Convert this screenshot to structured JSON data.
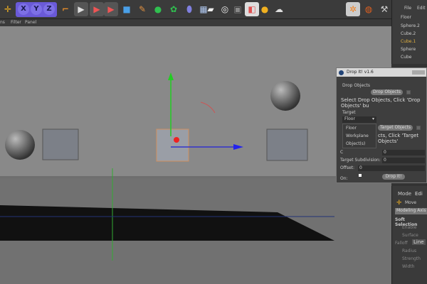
{
  "toolbar": {
    "axis_x": "X",
    "axis_y": "Y",
    "axis_z": "Z",
    "icons": [
      "move-icon",
      "axis-lock-icon",
      "coordinate-system-icon",
      "render-view-icon",
      "render-picture-viewer-icon",
      "render-settings-icon",
      "cube-icon",
      "pen-spline-icon",
      "subdivision-icon",
      "array-icon",
      "deformer-icon",
      "floor-icon",
      "camera-icon",
      "light-icon",
      "material-icon",
      "environment-icon",
      "sun-icon",
      "sky-icon"
    ]
  },
  "menubar": {
    "items": [
      "ns",
      "Filter",
      "Panel"
    ]
  },
  "object_manager": {
    "menu": [
      "File",
      "Edit"
    ],
    "objects": [
      {
        "name": "Floor",
        "active": false
      },
      {
        "name": "Sphere.2",
        "active": false
      },
      {
        "name": "Cube.2",
        "active": false
      },
      {
        "name": "Cube.1",
        "active": true
      },
      {
        "name": "Sphere",
        "active": false
      },
      {
        "name": "Cube",
        "active": false
      }
    ]
  },
  "dialog": {
    "title": "Drop It! v1.6",
    "drop_objects_heading": "Drop Objects",
    "drop_objects_button": "Drop Objects",
    "drop_hint": "Select Drop Objects, Click 'Drop Objects' bu",
    "target_heading": "Target",
    "target_selected": "Floor",
    "target_options": [
      "Floor",
      "Workplane",
      "Object(s)"
    ],
    "target_objects_button": "Target Objects",
    "target_hint": "cts, Click 'Target Objects'",
    "sub_label": "C",
    "sub_value": "0",
    "target_subdivision_label": "Target Subdivision:",
    "target_subdivision_value": "0",
    "offset_label": "Offset:",
    "offset_value": "0",
    "drop_button": "Drop It!",
    "footer": "On:"
  },
  "attributes": {
    "menu": [
      "Mode",
      "Edi"
    ],
    "tool": "Move",
    "tab": "Modeling Axis",
    "section": "Soft Selection",
    "fields": [
      "Enable",
      "Surface",
      "Falloff",
      "Radius",
      "Strength",
      "Width"
    ],
    "falloff_value": "Line"
  }
}
